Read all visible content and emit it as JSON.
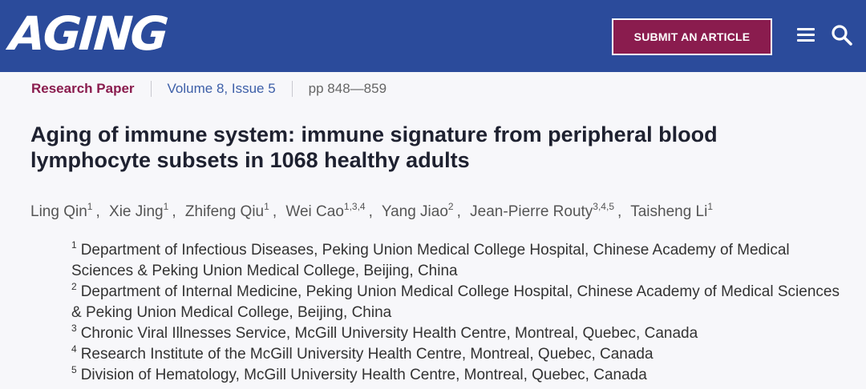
{
  "header": {
    "logo_text": "AGING",
    "submit_label": "SUBMIT AN ARTICLE",
    "menu_icon": "hamburger-icon",
    "search_icon": "search-icon",
    "colors": {
      "background": "#2b4b9b",
      "button": "#8a1c4e"
    }
  },
  "article": {
    "type": "Research Paper",
    "volume": "Volume 8, Issue 5",
    "pages": "pp 848—859",
    "title": "Aging of immune system: immune signature from peripheral blood lymphocyte subsets in 1068 healthy adults",
    "authors": [
      {
        "name": "Ling Qin",
        "sup": "1"
      },
      {
        "name": "Xie Jing",
        "sup": "1"
      },
      {
        "name": "Zhifeng Qiu",
        "sup": "1"
      },
      {
        "name": "Wei Cao",
        "sup": "1,3,4"
      },
      {
        "name": "Yang Jiao",
        "sup": "2"
      },
      {
        "name": "Jean-Pierre Routy",
        "sup": "3,4,5"
      },
      {
        "name": "Taisheng Li",
        "sup": "1"
      }
    ],
    "affiliations": [
      {
        "num": "1",
        "text": "Department of Infectious Diseases, Peking Union Medical College Hospital, Chinese Academy of Medical Sciences & Peking Union Medical College, Beijing, China"
      },
      {
        "num": "2",
        "text": "Department of Internal Medicine, Peking Union Medical College Hospital, Chinese Academy of Medical Sciences & Peking Union Medical College, Beijing, China"
      },
      {
        "num": "3",
        "text": "Chronic Viral Illnesses Service, McGill University Health Centre, Montreal, Quebec, Canada"
      },
      {
        "num": "4",
        "text": "Research Institute of the McGill University Health Centre, Montreal, Quebec, Canada"
      },
      {
        "num": "5",
        "text": "Division of Hematology, McGill University Health Centre, Montreal, Quebec, Canada"
      }
    ]
  }
}
